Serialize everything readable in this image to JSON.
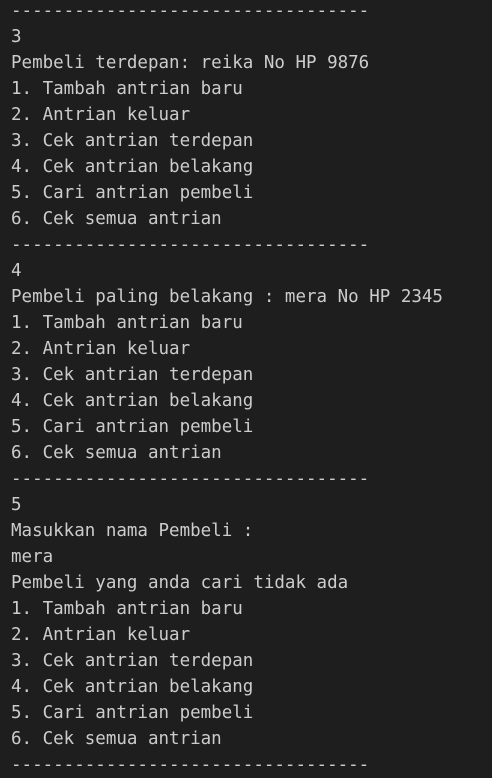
{
  "terminal": {
    "lines": [
      "----------------------------------",
      "3",
      "Pembeli terdepan: reika No HP 9876",
      "1. Tambah antrian baru",
      "2. Antrian keluar",
      "3. Cek antrian terdepan",
      "4. Cek antrian belakang",
      "5. Cari antrian pembeli",
      "6. Cek semua antrian",
      "----------------------------------",
      "4",
      "Pembeli paling belakang : mera No HP 2345",
      "1. Tambah antrian baru",
      "2. Antrian keluar",
      "3. Cek antrian terdepan",
      "4. Cek antrian belakang",
      "5. Cari antrian pembeli",
      "6. Cek semua antrian",
      "----------------------------------",
      "5",
      "Masukkan nama Pembeli :",
      "mera",
      "Pembeli yang anda cari tidak ada",
      "1. Tambah antrian baru",
      "2. Antrian keluar",
      "3. Cek antrian terdepan",
      "4. Cek antrian belakang",
      "5. Cari antrian pembeli",
      "6. Cek semua antrian",
      "----------------------------------"
    ]
  }
}
